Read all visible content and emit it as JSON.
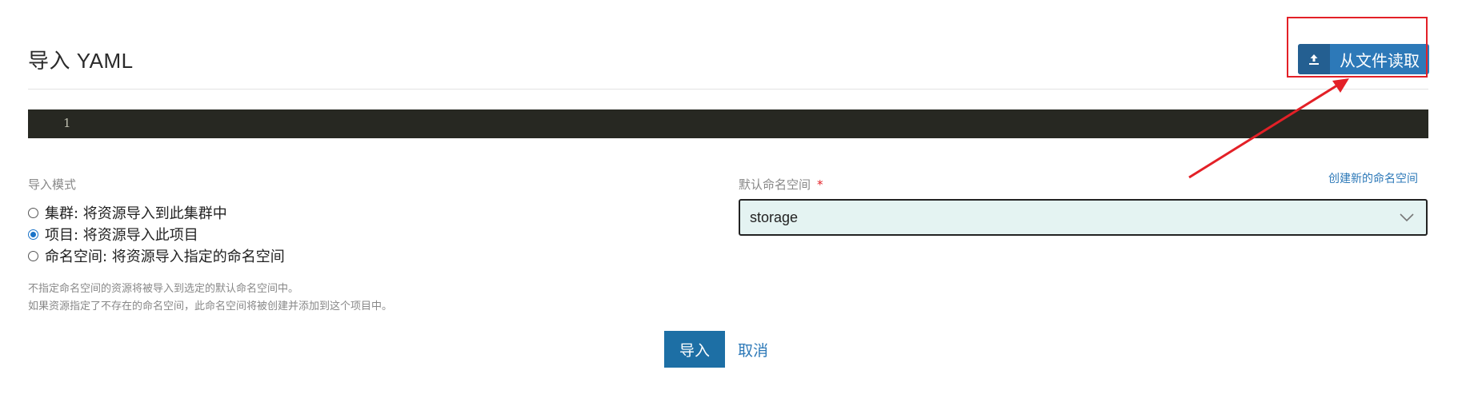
{
  "header": {
    "title": "导入 YAML",
    "read_file_label": "从文件读取"
  },
  "editor": {
    "line_number": "1"
  },
  "import_mode": {
    "label": "导入模式",
    "options": [
      {
        "label": "集群: 将资源导入到此集群中",
        "checked": false
      },
      {
        "label": "项目: 将资源导入此项目",
        "checked": true
      },
      {
        "label": "命名空间: 将资源导入指定的命名空间",
        "checked": false
      }
    ]
  },
  "notes": [
    "不指定命名空间的资源将被导入到选定的默认命名空间中。",
    "如果资源指定了不存在的命名空间，此命名空间将被创建并添加到这个项目中。"
  ],
  "namespace": {
    "label": "默认命名空间",
    "required_mark": "*",
    "create_link": "创建新的命名空间",
    "selected": "storage"
  },
  "actions": {
    "import_label": "导入",
    "cancel_label": "取消"
  },
  "colors": {
    "accent": "#2d79b8",
    "annotation": "#e32027",
    "editor_bg": "#272822",
    "select_bg": "#e4f3f2"
  },
  "icons": {
    "read_file": "upload-icon",
    "select": "chevron-down-icon"
  }
}
